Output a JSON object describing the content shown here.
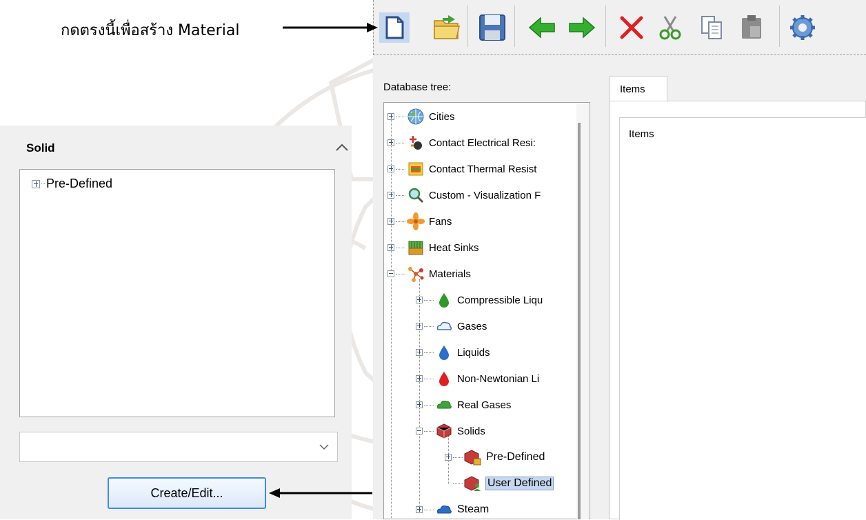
{
  "annotation": {
    "top_text": "กดตรงนี้เพื่อสร้าง Material"
  },
  "left_panel": {
    "title": "Solid",
    "tree_items": [
      "Pre-Defined"
    ],
    "combo_value": "",
    "create_button": "Create/Edit..."
  },
  "toolbar": {
    "buttons": [
      "new-icon",
      "open-icon",
      "save-icon",
      "back-icon",
      "forward-icon",
      "delete-icon",
      "cut-icon",
      "copy-icon",
      "paste-icon",
      "settings-icon"
    ]
  },
  "database": {
    "label": "Database tree:",
    "tree": [
      {
        "label": "Cities",
        "icon": "globe-icon"
      },
      {
        "label": "Contact Electrical Resi:",
        "icon": "electrical-contact-icon"
      },
      {
        "label": "Contact Thermal Resist",
        "icon": "thermal-contact-icon"
      },
      {
        "label": "Custom - Visualization F",
        "icon": "magnifier-icon"
      },
      {
        "label": "Fans",
        "icon": "fan-icon"
      },
      {
        "label": "Heat Sinks",
        "icon": "heat-sink-icon"
      },
      {
        "label": "Materials",
        "icon": "materials-icon"
      },
      {
        "label": "Compressible Liqu",
        "icon": "green-drop-icon"
      },
      {
        "label": "Gases",
        "icon": "cloud-icon"
      },
      {
        "label": "Liquids",
        "icon": "blue-drop-icon"
      },
      {
        "label": "Non-Newtonian Li",
        "icon": "red-drop-icon"
      },
      {
        "label": "Real Gases",
        "icon": "green-cloud-icon"
      },
      {
        "label": "Solids",
        "icon": "solids-icon"
      },
      {
        "label": "Pre-Defined",
        "icon": "locked-solids-icon"
      },
      {
        "label": "User Defined",
        "icon": "user-solids-icon"
      },
      {
        "label": "Steam",
        "icon": "steam-cloud-icon"
      }
    ]
  },
  "items": {
    "tab": "Items",
    "panel_text": "Items"
  },
  "colors": {
    "selection": "#c5d8ef",
    "button_border": "#3c8ee0"
  }
}
